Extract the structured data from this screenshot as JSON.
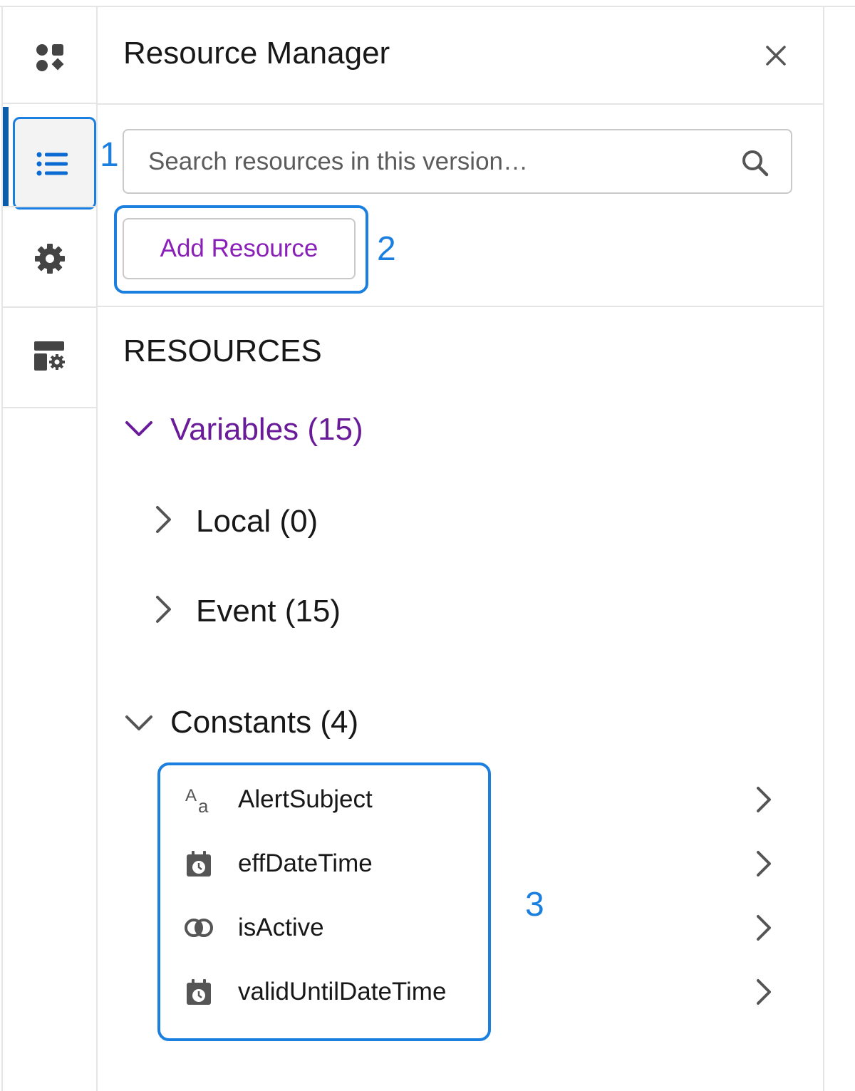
{
  "rail": {
    "items": [
      {
        "icon": "components-icon"
      },
      {
        "icon": "list-icon",
        "active": true
      },
      {
        "icon": "gear-icon"
      },
      {
        "icon": "layout-settings-icon"
      }
    ]
  },
  "panel": {
    "title": "Resource Manager",
    "close_icon": "close-icon"
  },
  "search": {
    "placeholder": "Search resources in this version…",
    "icon": "search-icon"
  },
  "toolbar": {
    "add_label": "Add Resource"
  },
  "resources": {
    "heading": "RESOURCES",
    "variables": {
      "label": "Variables (15)",
      "expanded": true
    },
    "local": {
      "label": "Local (0)",
      "expanded": false
    },
    "event": {
      "label": "Event (15)",
      "expanded": false
    },
    "constants": {
      "label": "Constants (4)",
      "expanded": true,
      "items": [
        {
          "label": "AlertSubject",
          "icon": "text-type-icon"
        },
        {
          "label": "effDateTime",
          "icon": "datetime-icon"
        },
        {
          "label": "isActive",
          "icon": "boolean-icon"
        },
        {
          "label": "validUntilDateTime",
          "icon": "datetime-icon"
        }
      ]
    }
  },
  "callouts": {
    "one": "1",
    "two": "2",
    "three": "3"
  },
  "colors": {
    "accent": "#1b7fe0",
    "brand_purple": "#6a1b9a",
    "button_text": "#8a1fb9"
  }
}
